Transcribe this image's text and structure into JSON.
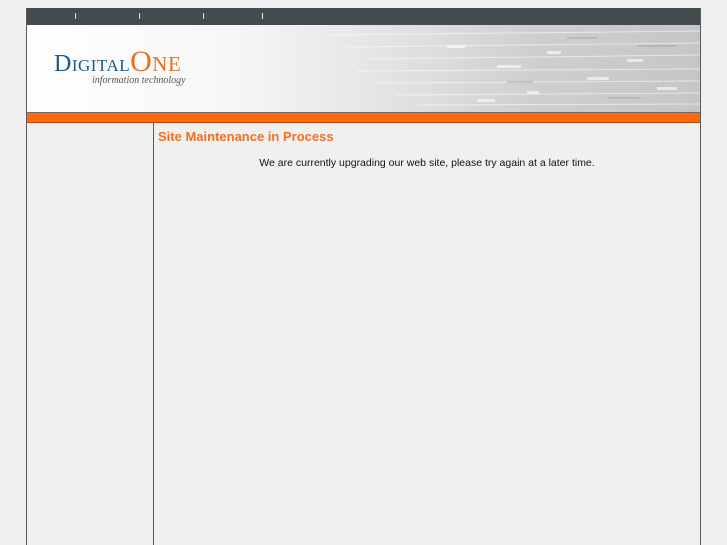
{
  "page": {
    "title": "Site Maintenance in Process",
    "message": "We are currently upgrading our web site, please try again at a later time."
  },
  "logo": {
    "word_first": "Digital",
    "word_second": "One",
    "tagline": "information technology"
  },
  "colors": {
    "topbar": "#454c50",
    "accent_orange": "#ff6a10",
    "title_orange": "#f07020",
    "logo_blue": "#1c5a8a",
    "background": "#f0f0f0"
  }
}
